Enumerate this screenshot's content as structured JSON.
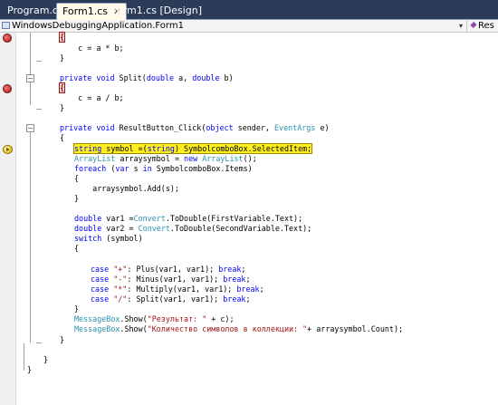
{
  "tabs": [
    {
      "label": "Program.cs",
      "active": false
    },
    {
      "label": "Form1.cs",
      "active": true,
      "close": "✕"
    },
    {
      "label": "Form1.cs [Design]",
      "active": false
    }
  ],
  "nav": {
    "type_dropdown": "WindowsDebuggingApplication.Form1",
    "member_dropdown": "Res",
    "dropdown_arrow": "▾"
  },
  "code": {
    "l1": "{",
    "l2": "    c = a * b;",
    "l3": "}",
    "l4_a": "private",
    "l4_b": " ",
    "l4_c": "void",
    "l4_d": " Split(",
    "l4_e": "double",
    "l4_f": " a, ",
    "l4_g": "double",
    "l4_h": " b)",
    "l5": "{",
    "l6": "    c = a / b;",
    "l7": "}",
    "l8_a": "private",
    "l8_b": " ",
    "l8_c": "void",
    "l8_d": " ResultButton_Click(",
    "l8_e": "object",
    "l8_f": " sender, ",
    "l8_g": "EventArgs",
    "l8_h": " e)",
    "l9": "{",
    "l10_a": "string",
    "l10_b": " symbol =(",
    "l10_c": "string",
    "l10_d": ") SymbolcomboBox.SelectedItem;",
    "l11_a": "ArrayList",
    "l11_b": " arraysymbol = ",
    "l11_c": "new",
    "l11_d": " ",
    "l11_e": "ArrayList",
    "l11_f": "();",
    "l12_a": "foreach",
    "l12_b": " (",
    "l12_c": "var",
    "l12_d": " s ",
    "l12_e": "in",
    "l12_f": " SymbolcomboBox.Items)",
    "l13": "{",
    "l14": "    arraysymbol.Add(s);",
    "l15": "}",
    "l16_a": "double",
    "l16_b": " var1 =",
    "l16_c": "Convert",
    "l16_d": ".ToDouble(FirstVariable.Text);",
    "l17_a": "double",
    "l17_b": " var2 = ",
    "l17_c": "Convert",
    "l17_d": ".ToDouble(SecondVariable.Text);",
    "l18_a": "switch",
    "l18_b": " (symbol)",
    "l19": "{",
    "c1_a": "case",
    "c1_b": " ",
    "c1_c": "\"+\"",
    "c1_d": ": Plus(var1, var1); ",
    "c1_e": "break",
    "c1_f": ";",
    "c2_a": "case",
    "c2_b": " ",
    "c2_c": "\"-\"",
    "c2_d": ": Minus(var1, var1); ",
    "c2_e": "break",
    "c2_f": ";",
    "c3_a": "case",
    "c3_b": " ",
    "c3_c": "\"*\"",
    "c3_d": ": Multiply(var1, var1); ",
    "c3_e": "break",
    "c3_f": ";",
    "c4_a": "case",
    "c4_b": " ",
    "c4_c": "\"/\"",
    "c4_d": ": Split(var1, var1); ",
    "c4_e": "break",
    "c4_f": ";",
    "l20": "}",
    "m1_a": "MessageBox",
    "m1_b": ".Show(",
    "m1_c": "\"Результат: \"",
    "m1_d": " + c);",
    "m2_a": "MessageBox",
    "m2_b": ".Show(",
    "m2_c": "\"Количество символов в коллекции: \"",
    "m2_d": "+ arraysymbol.Count);",
    "l21": "}",
    "l22": "}",
    "l23": "}"
  },
  "colors": {
    "keyword": "#0000ff",
    "type": "#2b91af",
    "string": "#a31515",
    "current_statement": "#ffef1c",
    "breakpoint": "#a01818"
  },
  "icons": [
    "breakpoint-icon",
    "current-statement-arrow-icon",
    "class-icon",
    "method-icon",
    "collapse-icon",
    "close-icon"
  ]
}
